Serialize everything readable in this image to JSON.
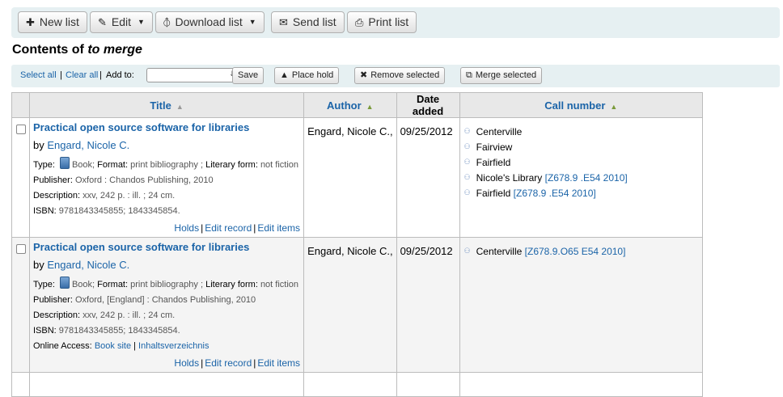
{
  "toolbar": {
    "new_list": "New list",
    "edit": "Edit",
    "download_list": "Download list",
    "send_list": "Send list",
    "print_list": "Print list"
  },
  "heading": {
    "prefix": "Contents of ",
    "list_name": "to merge"
  },
  "selection_bar": {
    "select_all": "Select all",
    "clear_all": "Clear all",
    "add_to_label": "Add to:",
    "add_to_value": "",
    "save": "Save",
    "place_hold": "Place hold",
    "remove_selected": "Remove selected",
    "merge_selected": "Merge selected"
  },
  "table": {
    "headers": {
      "title": "Title",
      "author": "Author",
      "date_added": "Date added",
      "call_number": "Call number"
    },
    "labels": {
      "type": "Type:",
      "format": "Format:",
      "literary_form": "Literary form:",
      "publisher": "Publisher:",
      "description": "Description:",
      "isbn": "ISBN:",
      "online_access": "Online Access:",
      "by": "by",
      "holds": "Holds",
      "edit_record": "Edit record",
      "edit_items": "Edit items"
    },
    "rows": [
      {
        "title": "Practical open source software for libraries",
        "author_link": "Engard, Nicole C.",
        "type_value": "Book;",
        "format_value": "print bibliography ;",
        "literary_value": "not fiction",
        "publisher_value": "Oxford : Chandos Publishing, 2010",
        "description_value": "xxv, 242 p. : ill. ; 24 cm.",
        "isbn_value": "9781843345855; 1843345854.",
        "author": "Engard, Nicole C.,",
        "date_added": "09/25/2012",
        "call_numbers": [
          {
            "location": "Centerville",
            "number": ""
          },
          {
            "location": "Fairview",
            "number": ""
          },
          {
            "location": "Fairfield",
            "number": ""
          },
          {
            "location": "Nicole's Library",
            "number": "[Z678.9 .E54 2010]"
          },
          {
            "location": "Fairfield",
            "number": "[Z678.9 .E54 2010]"
          }
        ]
      },
      {
        "title": "Practical open source software for libraries",
        "author_link": "Engard, Nicole C.",
        "type_value": "Book;",
        "format_value": "print bibliography ;",
        "literary_value": "not fiction",
        "publisher_value": "Oxford, [England] : Chandos Publishing, 2010",
        "description_value": "xxv, 242 p. : ill. ; 24 cm.",
        "isbn_value": "9781843345855; 1843345854.",
        "online_links": [
          "Book site",
          "Inhaltsverzeichnis"
        ],
        "author": "Engard, Nicole C.,",
        "date_added": "09/25/2012",
        "call_numbers": [
          {
            "location": "Centerville",
            "number": "[Z678.9.O65 E54 2010]"
          }
        ]
      }
    ]
  }
}
